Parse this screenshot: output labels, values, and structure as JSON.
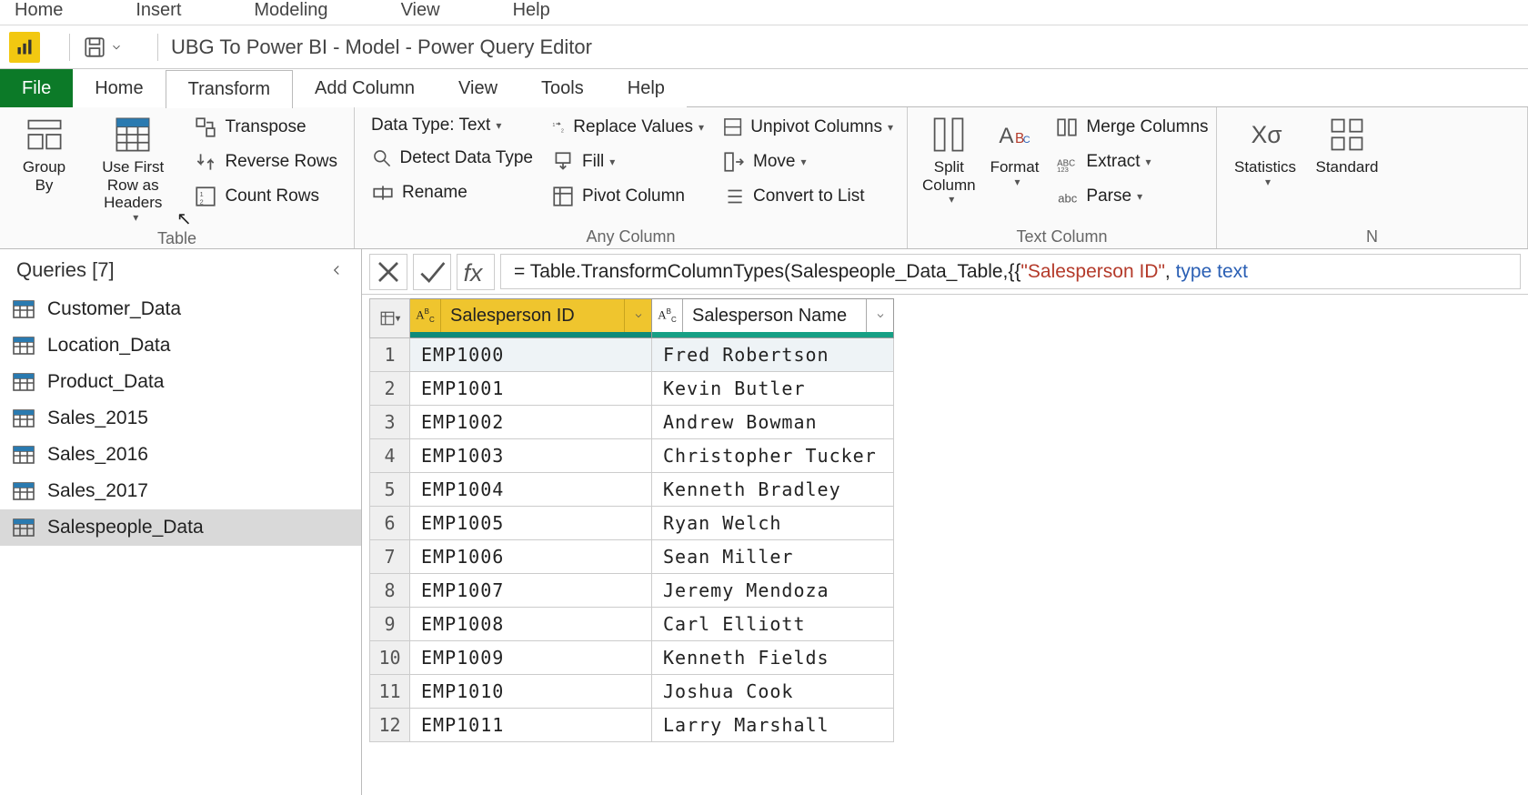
{
  "top_menu": [
    "Home",
    "Insert",
    "Modeling",
    "View",
    "Help"
  ],
  "window_title": "UBG To Power BI - Model - Power Query Editor",
  "ribbon_tabs": {
    "file": "File",
    "items": [
      "Home",
      "Transform",
      "Add Column",
      "View",
      "Tools",
      "Help"
    ],
    "active_index": 1
  },
  "ribbon": {
    "table_group": {
      "label": "Table",
      "group_by": "Group By",
      "use_first_row": "Use First Row as Headers",
      "transpose": "Transpose",
      "reverse_rows": "Reverse Rows",
      "count_rows": "Count Rows"
    },
    "any_column_group": {
      "label": "Any Column",
      "data_type": "Data Type: Text",
      "detect": "Detect Data Type",
      "rename": "Rename",
      "replace": "Replace Values",
      "fill": "Fill",
      "pivot": "Pivot Column",
      "unpivot": "Unpivot Columns",
      "move": "Move",
      "convert": "Convert to List"
    },
    "text_column_group": {
      "label": "Text Column",
      "split": "Split Column",
      "format": "Format",
      "merge": "Merge Columns",
      "extract": "Extract",
      "parse": "Parse"
    },
    "number_group": {
      "statistics": "Statistics",
      "standard": "Standard",
      "label": "N"
    }
  },
  "queries": {
    "header": "Queries [7]",
    "items": [
      "Customer_Data",
      "Location_Data",
      "Product_Data",
      "Sales_2015",
      "Sales_2016",
      "Sales_2017",
      "Salespeople_Data"
    ],
    "selected_index": 6
  },
  "formula": {
    "prefix": "= Table.TransformColumnTypes(Salespeople_Data_Table,{{",
    "string": "\"Salesperson ID\"",
    "mid": ", ",
    "type_kw": "type",
    "type_name": " text"
  },
  "grid": {
    "columns": [
      {
        "name": "Salesperson ID",
        "type_label": "ABC",
        "selected": true
      },
      {
        "name": "Salesperson Name",
        "type_label": "ABC",
        "selected": false
      }
    ],
    "rows": [
      {
        "n": "1",
        "c": [
          "EMP1000",
          "Fred Robertson"
        ]
      },
      {
        "n": "2",
        "c": [
          "EMP1001",
          "Kevin Butler"
        ]
      },
      {
        "n": "3",
        "c": [
          "EMP1002",
          "Andrew Bowman"
        ]
      },
      {
        "n": "4",
        "c": [
          "EMP1003",
          "Christopher Tucker"
        ]
      },
      {
        "n": "5",
        "c": [
          "EMP1004",
          "Kenneth Bradley"
        ]
      },
      {
        "n": "6",
        "c": [
          "EMP1005",
          "Ryan Welch"
        ]
      },
      {
        "n": "7",
        "c": [
          "EMP1006",
          "Sean Miller"
        ]
      },
      {
        "n": "8",
        "c": [
          "EMP1007",
          "Jeremy Mendoza"
        ]
      },
      {
        "n": "9",
        "c": [
          "EMP1008",
          "Carl Elliott"
        ]
      },
      {
        "n": "10",
        "c": [
          "EMP1009",
          "Kenneth Fields"
        ]
      },
      {
        "n": "11",
        "c": [
          "EMP1010",
          "Joshua Cook"
        ]
      },
      {
        "n": "12",
        "c": [
          "EMP1011",
          "Larry Marshall"
        ]
      }
    ]
  }
}
